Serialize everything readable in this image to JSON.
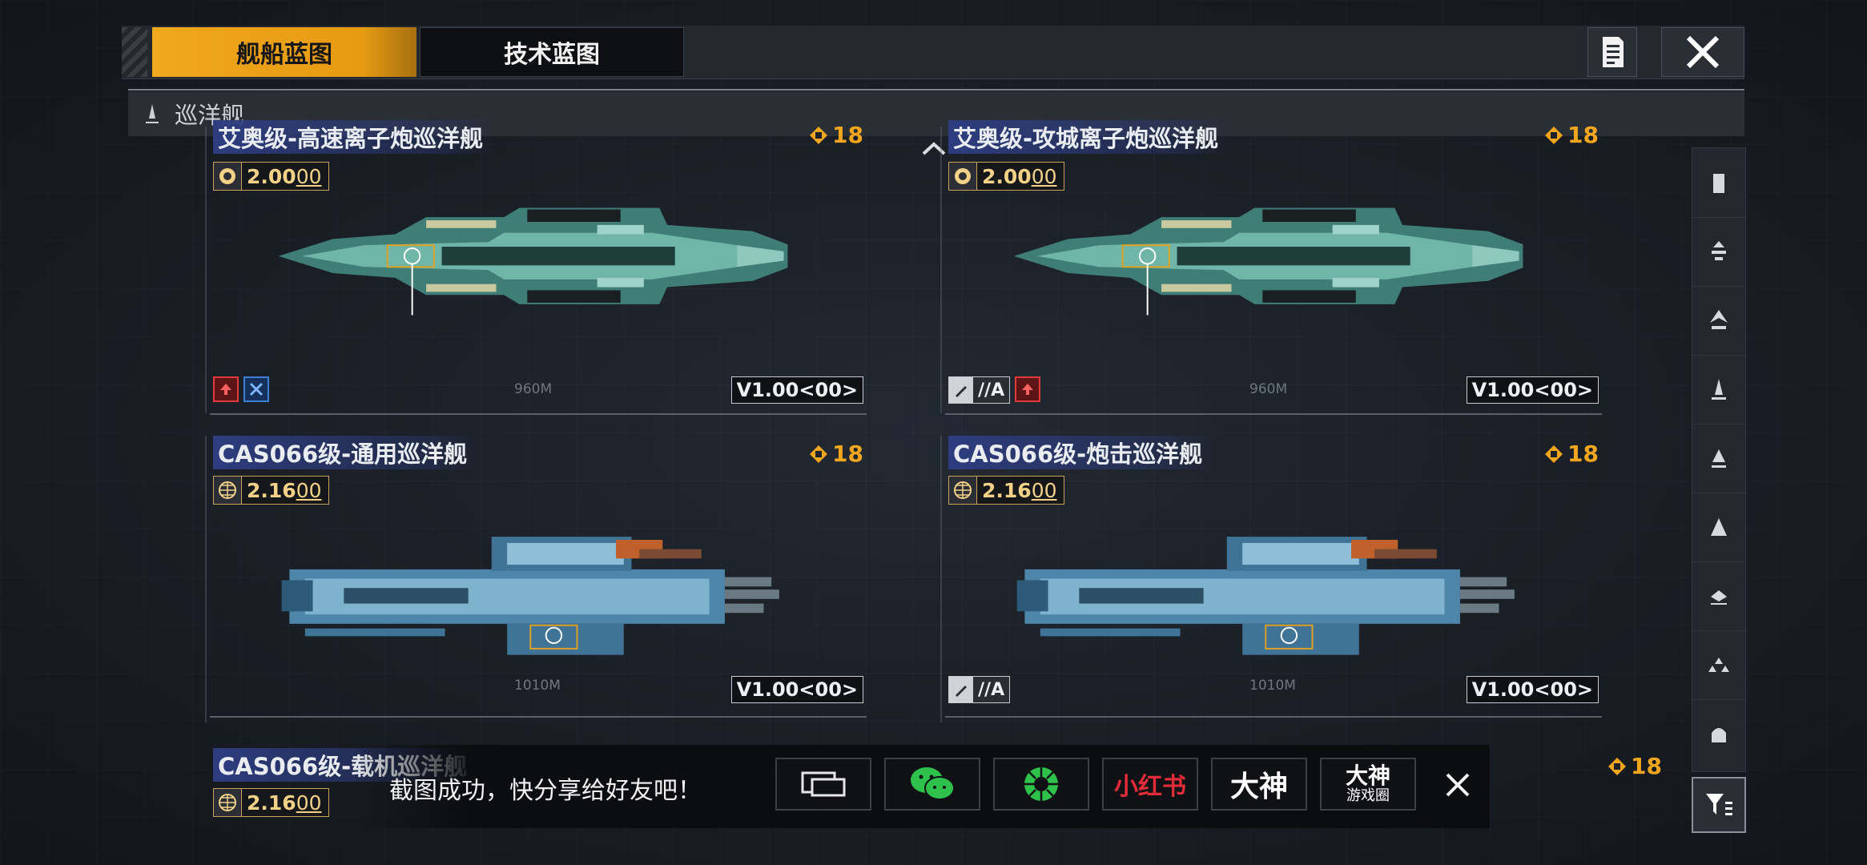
{
  "tabs": {
    "ship_blueprint": "舰船蓝图",
    "tech_blueprint": "技术蓝图"
  },
  "category": {
    "label": "巡洋舰"
  },
  "cards": [
    {
      "title": "艾奥级-高速离子炮巡洋舰",
      "cost": "18",
      "price_main": "2.00",
      "price_sub": "00",
      "length": "960M",
      "version": "V1.00<00>",
      "tags": [
        "red-upgrade-icon",
        "blue-crossed-icon"
      ]
    },
    {
      "title": "艾奥级-攻城离子炮巡洋舰",
      "cost": "18",
      "price_main": "2.00",
      "price_sub": "00",
      "length": "960M",
      "version": "V1.00<00>",
      "tag_grey_label": "//A",
      "tags": [
        "grey-weapon-icon",
        "red-upgrade-icon"
      ]
    },
    {
      "title": "CAS066级-通用巡洋舰",
      "cost": "18",
      "price_main": "2.16",
      "price_sub": "00",
      "length": "1010M",
      "version": "V1.00<00>",
      "tags": []
    },
    {
      "title": "CAS066级-炮击巡洋舰",
      "cost": "18",
      "price_main": "2.16",
      "price_sub": "00",
      "length": "1010M",
      "version": "V1.00<00>",
      "tag_grey_label": "//A",
      "tags": [
        "grey-weapon-icon"
      ]
    },
    {
      "title": "CAS066级-载机巡洋舰",
      "cost": "18",
      "price_main": "2.16",
      "price_sub": "00"
    }
  ],
  "share": {
    "message": "截图成功，快分享给好友吧！",
    "xiaohongshu": "小红书",
    "dashen": "大神",
    "dashen_circle_top": "大神",
    "dashen_circle_bottom": "游戏圈"
  },
  "filter_icons": [
    "carrier-icon",
    "frigate-icon",
    "destroyer-icon",
    "cruiser-icon",
    "battlecruiser-icon",
    "battleship-icon",
    "auxiliary-icon",
    "fighter-icon",
    "corvette-icon"
  ],
  "colors": {
    "accent": "#f0a81c",
    "title_bg": "#2d3d80",
    "price_gold": "#f3d288",
    "cost_orange": "#f2a61e"
  }
}
